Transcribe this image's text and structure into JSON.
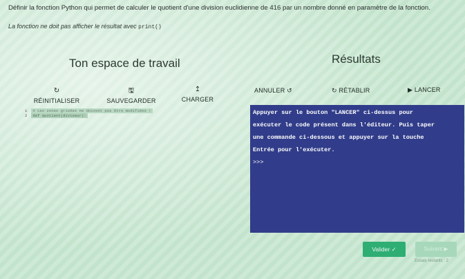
{
  "instructions": {
    "line1": "Définir la fonction Python qui permet de calculer le quotient d'une division euclidienne de 416 par un nombre donné en paramètre de la fonction.",
    "line2": "La fonction ne doit pas afficher le résultat avec",
    "line2_code": "print()"
  },
  "headings": {
    "workspace": "Ton espace de travail",
    "results": "Résultats"
  },
  "toolbar": {
    "reset": {
      "label": "RÉINITIALISER",
      "icon": "↻"
    },
    "save": {
      "label": "SAUVEGARDER",
      "icon": "🖫"
    },
    "load": {
      "label": "CHARGER",
      "icon": "↥"
    },
    "undo": {
      "label": "ANNULER",
      "icon": "↺"
    },
    "redo": {
      "label": "RÉTABLIR",
      "icon": "↻"
    },
    "run": {
      "label": "LANCER",
      "icon": "▶"
    }
  },
  "editor": {
    "lines": [
      {
        "num": "1",
        "text": "# Les zones grisées ne doivent pas être modifiées !"
      },
      {
        "num": "2",
        "text": "def quotient(diviseur):"
      }
    ]
  },
  "console": {
    "line1": "Appuyer sur le bouton \"LANCER\" ci-dessus pour",
    "line2": "exécuter le code présent dans l'éditeur. Puis taper",
    "line3": "une commande ci-dessous et appuyer sur la touche",
    "line4": "Entrée pour l'exécuter.",
    "prompt": ">>>"
  },
  "actions": {
    "validate": "Valider ✓",
    "next": "Suivant ▶",
    "attempts": "Essais restants : 2"
  }
}
